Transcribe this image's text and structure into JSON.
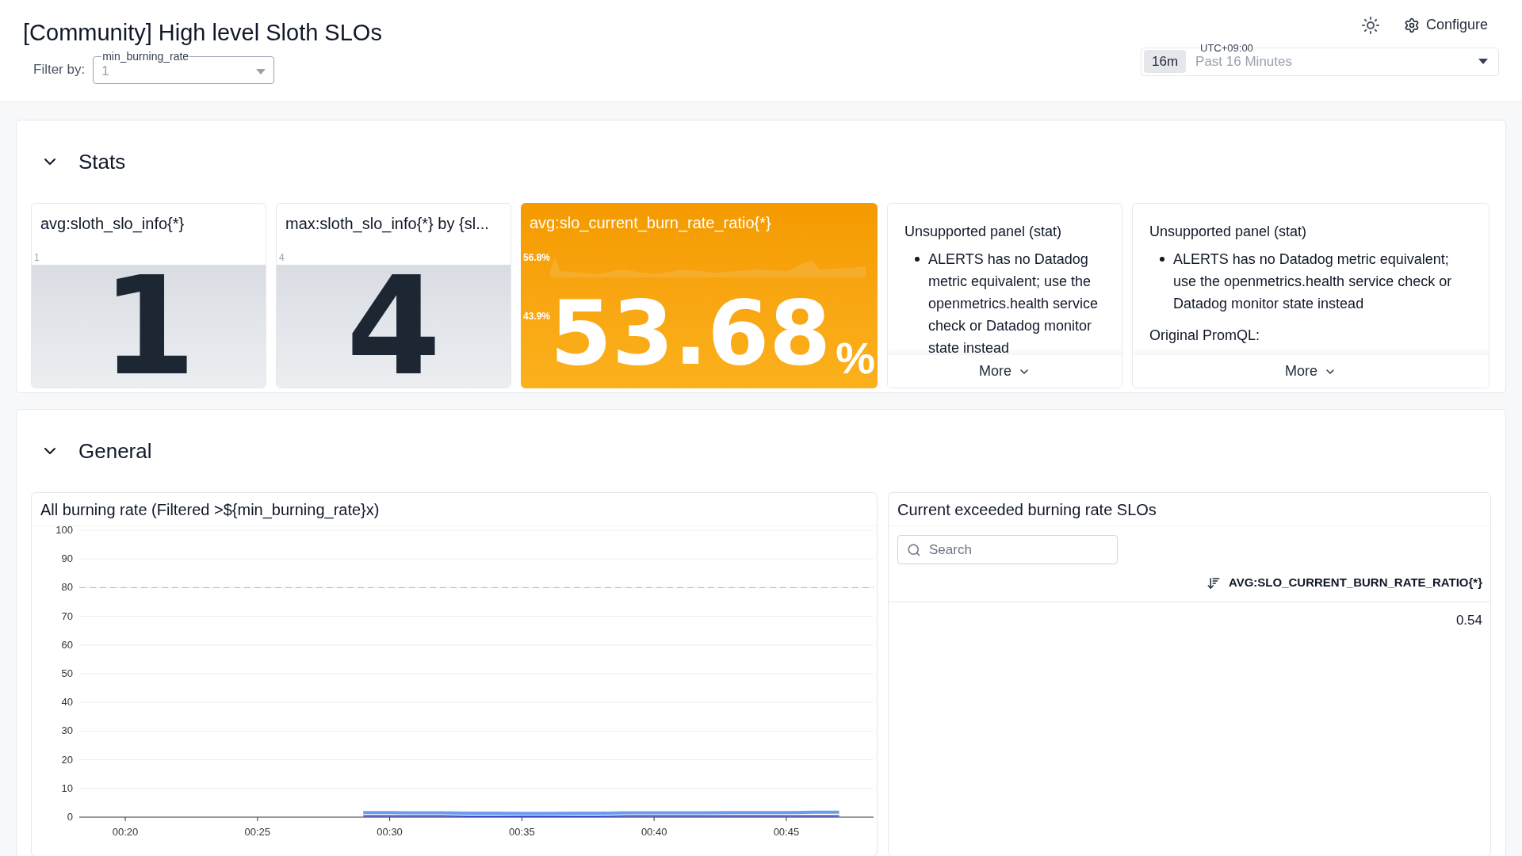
{
  "header": {
    "title": "[Community] High level Sloth SLOs",
    "configure": "Configure"
  },
  "filter": {
    "label": "Filter by:",
    "variable": "min_burning_rate",
    "value": "1"
  },
  "time": {
    "timezone": "UTC+09:00",
    "badge": "16m",
    "range": "Past 16 Minutes"
  },
  "sections": [
    {
      "title": "Stats",
      "expanded": true,
      "widgets": [
        {
          "kind": "stat",
          "title": "avg:sloth_slo_info{*}",
          "axis_label": "1",
          "value": "1"
        },
        {
          "kind": "stat",
          "title": "max:sloth_slo_info{*} by {sl...",
          "axis_label": "4",
          "value": "4"
        },
        {
          "kind": "stat_colored",
          "title": "avg:slo_current_burn_rate_ratio{*}",
          "value": "53.68",
          "unit": "%",
          "marks": [
            "56.8%",
            "43.9%"
          ]
        },
        {
          "kind": "unsupported",
          "title": "Unsupported panel (stat)",
          "bullets": [
            "ALERTS has no Datadog metric equivalent; use the openmetrics.health service check or Datadog monitor state instead"
          ],
          "more": "More"
        },
        {
          "kind": "unsupported",
          "title": "Unsupported panel (stat)",
          "bullets": [
            "ALERTS has no Datadog metric equivalent; use the openmetrics.health service check or Datadog monitor state instead"
          ],
          "extra": "Original PromQL:",
          "more": "More"
        }
      ]
    },
    {
      "title": "General",
      "expanded": true,
      "widgets": [
        {
          "kind": "timeseries",
          "title": "All burning rate (Filtered >${min_burning_rate}x)",
          "chart_data": {
            "type": "line",
            "x": [
              29,
              30,
              31,
              32,
              33,
              34,
              35,
              36,
              37,
              38,
              39,
              40,
              41,
              42,
              43,
              44,
              45,
              46,
              47
            ],
            "series": [
              {
                "color": "#6b9cf0",
                "values": [
                  1.6,
                  1.6,
                  1.5,
                  1.5,
                  1.4,
                  1.4,
                  1.3,
                  1.3,
                  1.4,
                  1.4,
                  1.5,
                  1.5,
                  1.5,
                  1.5,
                  1.6,
                  1.6,
                  1.6,
                  1.7,
                  1.7
                ]
              },
              {
                "color": "#3f4fc8",
                "values": [
                  0.4,
                  0.4,
                  0.4,
                  0.4,
                  0.3,
                  0.3,
                  0.3,
                  0.3,
                  0.3,
                  0.3,
                  0.4,
                  0.4,
                  0.4,
                  0.4,
                  0.4,
                  0.4,
                  0.4,
                  0.4,
                  0.4
                ]
              }
            ],
            "ylim": [
              0,
              100
            ],
            "yticks": [
              0,
              10,
              20,
              30,
              40,
              50,
              60,
              70,
              80,
              90,
              100
            ],
            "xticks": [
              {
                "value": 20,
                "label": "00:20"
              },
              {
                "value": 25,
                "label": "00:25"
              },
              {
                "value": 30,
                "label": "00:30"
              },
              {
                "value": 35,
                "label": "00:35"
              },
              {
                "value": 40,
                "label": "00:40"
              },
              {
                "value": 45,
                "label": "00:45"
              }
            ],
            "grid": true,
            "xlim": [
              18.26,
              48.3
            ],
            "ref_lines": [
              {
                "axis": "y",
                "value": 80,
                "color": "#e0a0a0"
              }
            ]
          }
        },
        {
          "kind": "table",
          "title": "Current exceeded burning rate SLOs",
          "search_placeholder": "Search",
          "column": "AVG:SLO_CURRENT_BURN_RATE_RATIO{*}",
          "rows": [
            "0.54"
          ]
        }
      ]
    }
  ]
}
